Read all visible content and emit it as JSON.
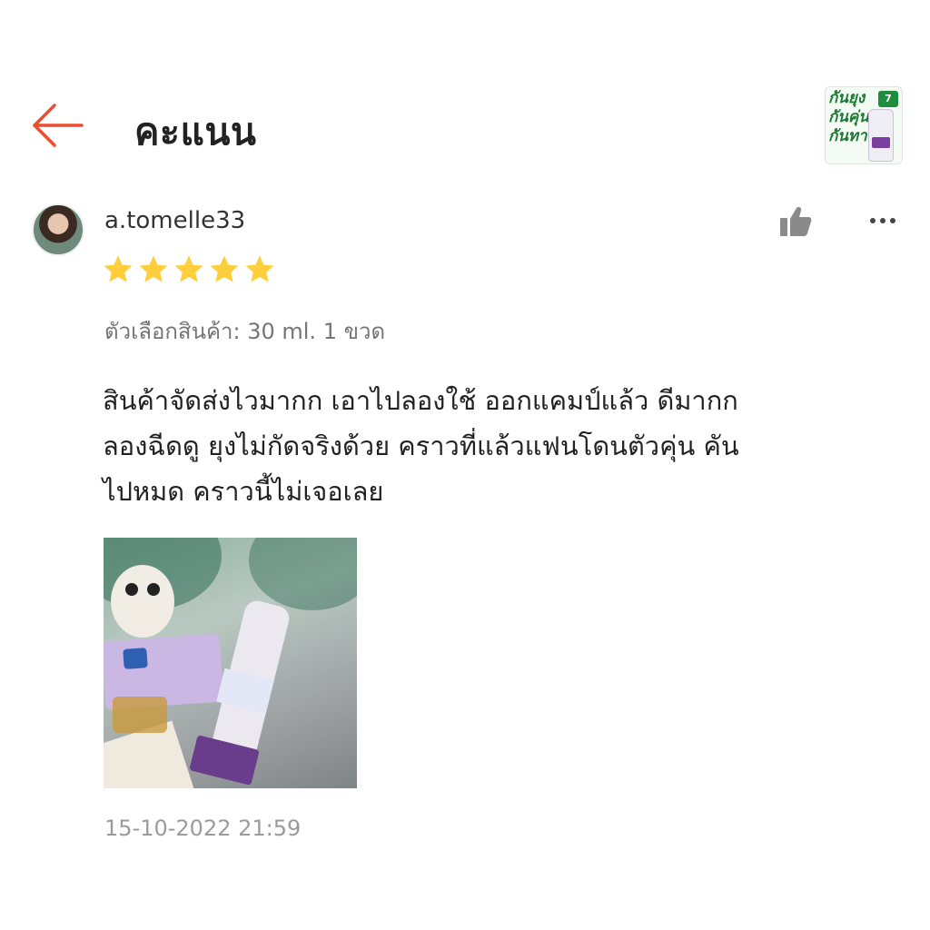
{
  "header": {
    "title": "คะแนน",
    "back_icon": "arrow-left-icon",
    "accent_color": "#ee4d2d",
    "product_thumb": {
      "text_lines": [
        "กันยุง",
        "กันคุ่น",
        "กันทาก"
      ],
      "badge": "7"
    }
  },
  "review": {
    "username": "a.tomelle33",
    "rating": 5,
    "max_rating": 5,
    "star_color": "#ffce3d",
    "variation": "ตัวเลือกสินค้า: 30 ml. 1 ขวด",
    "text_lines": [
      "สินค้าจัดส่งไวมากก เอาไปลองใช้ ออกแคมป์แล้ว ดีมากก",
      "ลองฉีดดู ยุงไม่กัดจริงด้วย คราวที่แล้วแฟนโดนตัวคุ่น คัน",
      "ไปหมด คราวนี้ไม่เจอเลย"
    ],
    "timestamp": "15-10-2022 21:59",
    "like_icon": "thumbs-up-icon",
    "more_icon": "more-horizontal-icon"
  }
}
